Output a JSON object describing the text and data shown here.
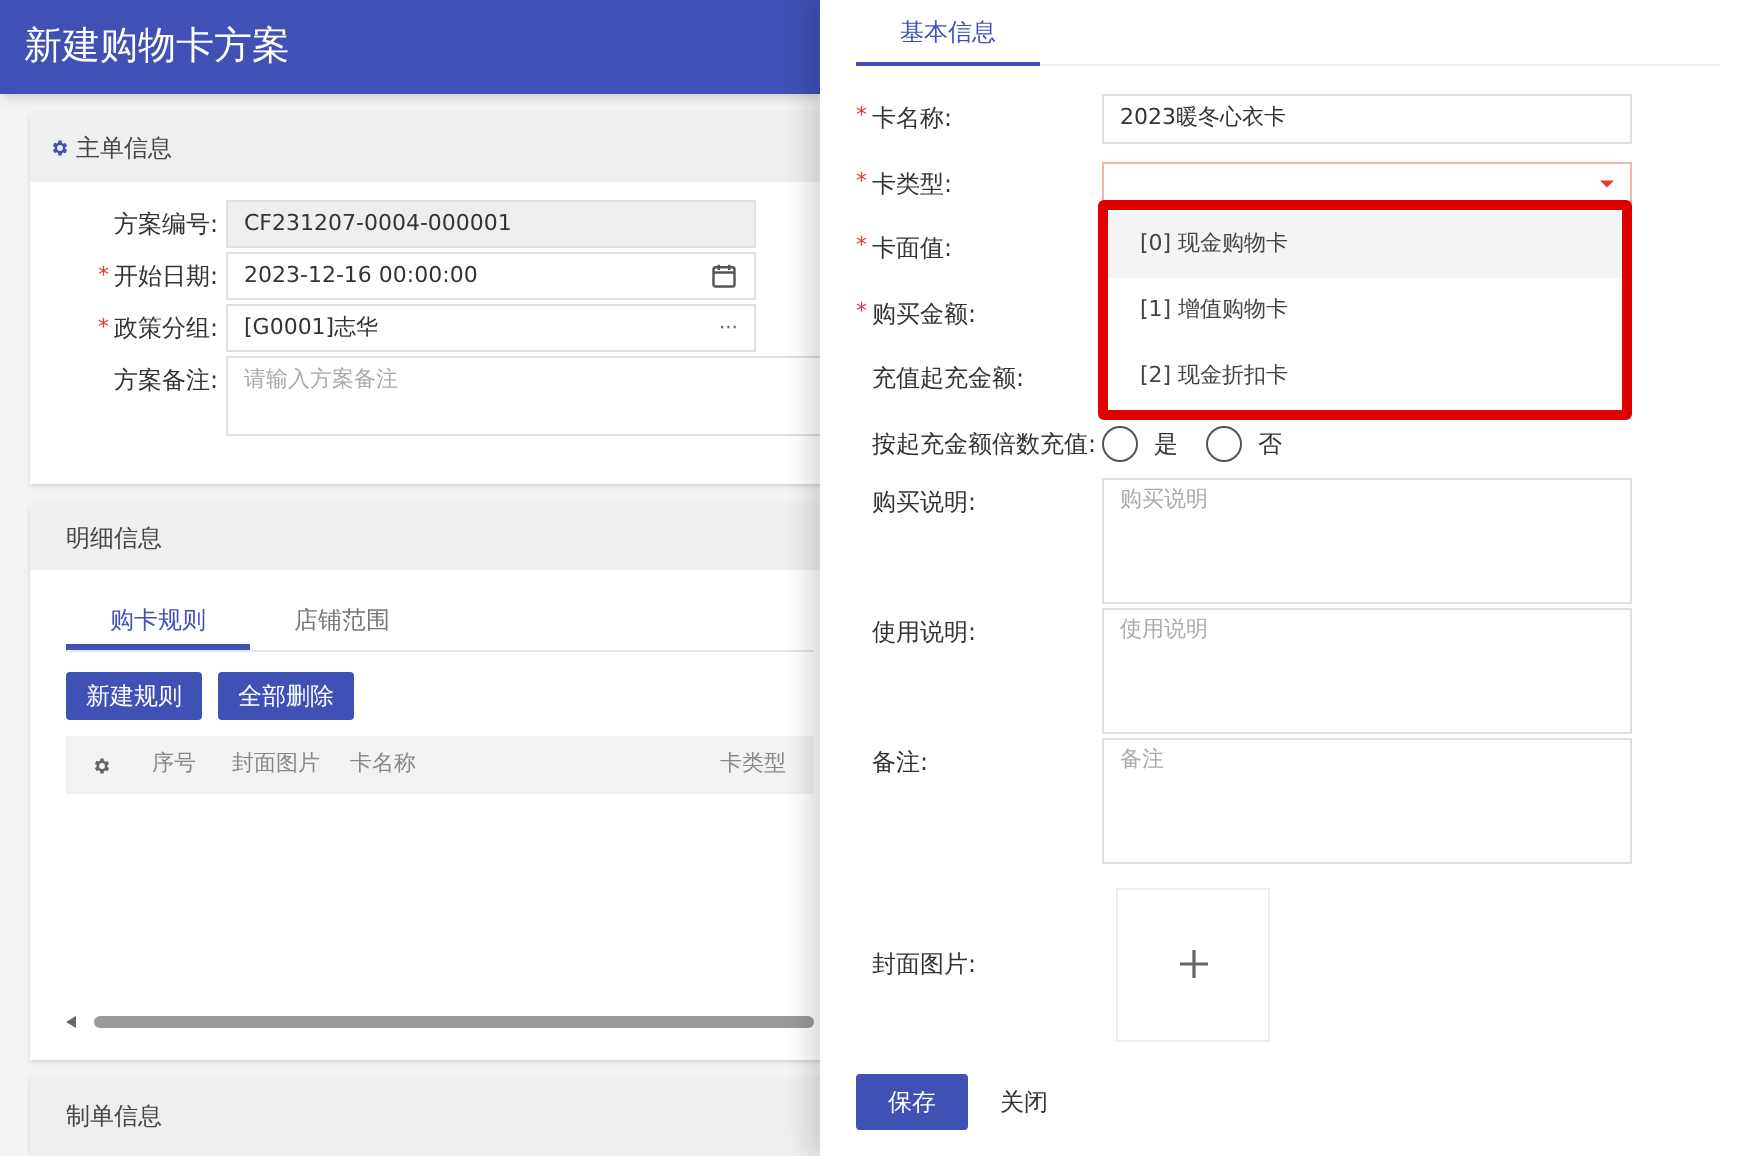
{
  "page_title": "新建购物卡方案",
  "main_section": {
    "title": "主单信息",
    "fields": [
      {
        "label": "方案编号:",
        "kind": "readonly",
        "value": "CF231207-0004-000001"
      },
      {
        "label": "开始日期:",
        "kind": "date",
        "value": "2023-12-16 00:00:00",
        "required_mark": "*"
      },
      {
        "label": "政策分组:",
        "kind": "lookup",
        "value": "[G0001]志华",
        "required_mark": "*",
        "button": "···"
      },
      {
        "label": "方案备注:",
        "kind": "textarea",
        "placeholder": "请输入方案备注"
      }
    ]
  },
  "detail_section": {
    "title": "明细信息",
    "tabs": [
      {
        "label": "购卡规则",
        "selected": true
      },
      {
        "label": "店铺范围",
        "selected": false
      }
    ],
    "buttons": [
      "新建规则",
      "全部删除"
    ],
    "table": {
      "columns": [
        "序号",
        "封面图片",
        "卡名称",
        "卡类型"
      ]
    }
  },
  "maker_section": {
    "title": "制单信息"
  },
  "drawer": {
    "tabs": [
      {
        "label": "基本信息",
        "selected": true
      }
    ],
    "fields": [
      {
        "label": "卡名称:",
        "kind": "text",
        "value": "2023暖冬心衣卡",
        "required_mark": "*"
      },
      {
        "label": "卡类型:",
        "kind": "select",
        "required_mark": "*",
        "open": true
      },
      {
        "label": "卡面值:",
        "kind": "hidden",
        "required_mark": "*"
      },
      {
        "label": "购买金额:",
        "kind": "hidden",
        "required_mark": "*"
      },
      {
        "label": "充值起充金额:",
        "kind": "hidden"
      },
      {
        "label": "按起充金额倍数充值:",
        "kind": "radio",
        "options": [
          {
            "label": "是",
            "selected": false
          },
          {
            "label": "否",
            "selected": false
          }
        ]
      },
      {
        "label": "购买说明:",
        "kind": "textarea",
        "placeholder": "购买说明"
      },
      {
        "label": "使用说明:",
        "kind": "textarea",
        "placeholder": "使用说明"
      },
      {
        "label": "备注:",
        "kind": "textarea",
        "placeholder": "备注"
      },
      {
        "label": "封面图片:",
        "kind": "upload"
      }
    ],
    "dropdown_options": [
      {
        "label": "[0] 现金购物卡",
        "selected": true
      },
      {
        "label": "[1] 增值购物卡",
        "selected": false
      },
      {
        "label": "[2] 现金折扣卡",
        "selected": false
      }
    ],
    "buttons": [
      {
        "label": "保存",
        "kind": "primary"
      },
      {
        "label": "关闭",
        "kind": "plain"
      }
    ]
  }
}
